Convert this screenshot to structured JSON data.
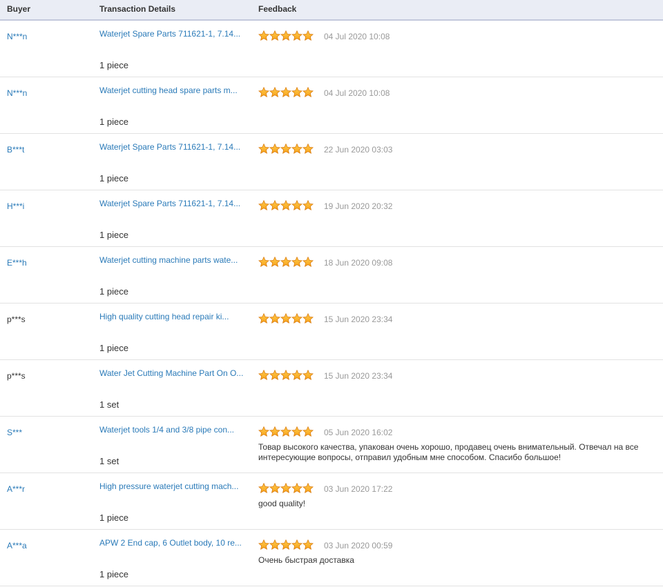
{
  "header": {
    "buyer": "Buyer",
    "details": "Transaction Details",
    "feedback": "Feedback"
  },
  "colors": {
    "link": "#2a7ab8",
    "star": "#f7a21b",
    "header_bg": "#eaedf5",
    "date": "#999999"
  },
  "rows": [
    {
      "buyer": "N***n",
      "buyer_link": true,
      "product": "Waterjet Spare Parts 711621-1, 7.14...",
      "qty": "1 piece",
      "rating": 5,
      "date": "04 Jul 2020 10:08",
      "comment": ""
    },
    {
      "buyer": "N***n",
      "buyer_link": true,
      "product": "Waterjet cutting head spare parts m...",
      "qty": "1 piece",
      "rating": 5,
      "date": "04 Jul 2020 10:08",
      "comment": ""
    },
    {
      "buyer": "B***t",
      "buyer_link": true,
      "product": "Waterjet Spare Parts 711621-1, 7.14...",
      "qty": "1 piece",
      "rating": 5,
      "date": "22 Jun 2020 03:03",
      "comment": ""
    },
    {
      "buyer": "H***i",
      "buyer_link": true,
      "product": "Waterjet Spare Parts 711621-1, 7.14...",
      "qty": "1 piece",
      "rating": 5,
      "date": "19 Jun 2020 20:32",
      "comment": ""
    },
    {
      "buyer": "E***h",
      "buyer_link": true,
      "product": "Waterjet cutting machine parts wate...",
      "qty": "1 piece",
      "rating": 5,
      "date": "18 Jun 2020 09:08",
      "comment": ""
    },
    {
      "buyer": "p***s",
      "buyer_link": false,
      "product": "High quality cutting head repair ki...",
      "qty": "1 piece",
      "rating": 5,
      "date": "15 Jun 2020 23:34",
      "comment": ""
    },
    {
      "buyer": "p***s",
      "buyer_link": false,
      "product": "Water Jet Cutting Machine Part On O...",
      "qty": "1 set",
      "rating": 5,
      "date": "15 Jun 2020 23:34",
      "comment": ""
    },
    {
      "buyer": "S***",
      "buyer_link": true,
      "product": "Waterjet tools 1/4 and 3/8 pipe con...",
      "qty": "1 set",
      "rating": 5,
      "date": "05 Jun 2020 16:02",
      "comment": "Товар высокого качества, упакован очень хорошо, продавец очень внимательный. Отвечал на все интересующие вопросы, отправил удобным мне способом. Спасибо большое!"
    },
    {
      "buyer": "A***r",
      "buyer_link": true,
      "product": "High pressure waterjet cutting mach...",
      "qty": "1 piece",
      "rating": 5,
      "date": "03 Jun 2020 17:22",
      "comment": "good quality!"
    },
    {
      "buyer": "A***a",
      "buyer_link": true,
      "product": "APW 2 End cap, 6 Outlet body, 10 re...",
      "qty": "1 piece",
      "rating": 5,
      "date": "03 Jun 2020 00:59",
      "comment": "Очень быстрая доставка"
    }
  ]
}
